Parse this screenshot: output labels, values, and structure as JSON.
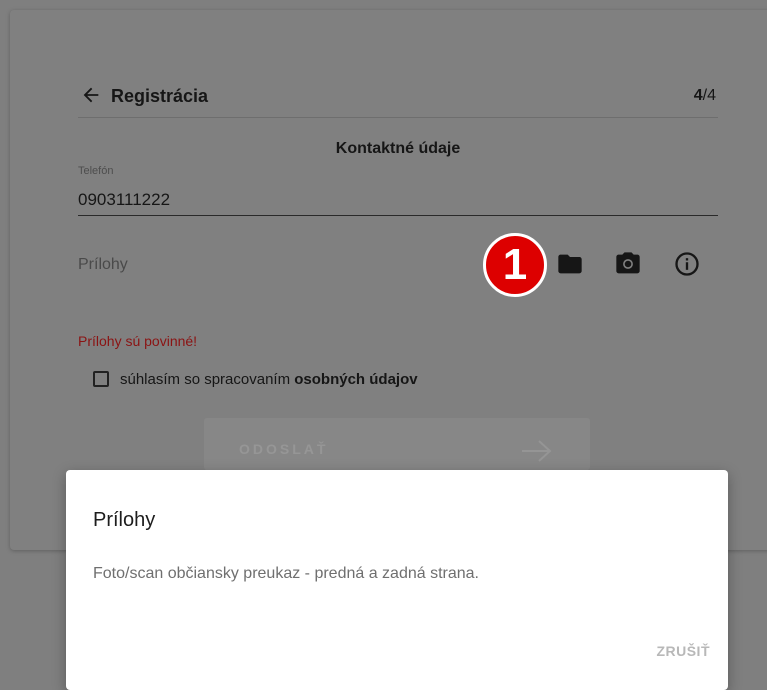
{
  "header": {
    "title": "Registrácia",
    "step_current": "4",
    "step_total": "/4"
  },
  "form": {
    "section_title": "Kontaktné údaje",
    "phone_label": "Telefón",
    "phone_value": "0903111222",
    "attachments_label": "Prílohy",
    "step_badge": "1",
    "error_text": "Prílohy sú povinné!",
    "consent_text": "súhlasím so spracovaním ",
    "consent_bold": "osobných údajov",
    "submit_label": "ODOSLAŤ"
  },
  "icons": {
    "back": "arrow-left-icon",
    "folder": "folder-icon",
    "camera": "camera-icon",
    "info": "info-icon",
    "submit_arrow": "arrow-right-icon"
  },
  "dialog": {
    "title": "Prílohy",
    "text": "Foto/scan občiansky preukaz - predná a zadná strana.",
    "cancel_label": "ZRUŠIŤ"
  },
  "colors": {
    "overlay": "#7f7f7f",
    "error": "#8b1313",
    "badge": "#dd0000",
    "dialog_bg": "#ffffff"
  }
}
